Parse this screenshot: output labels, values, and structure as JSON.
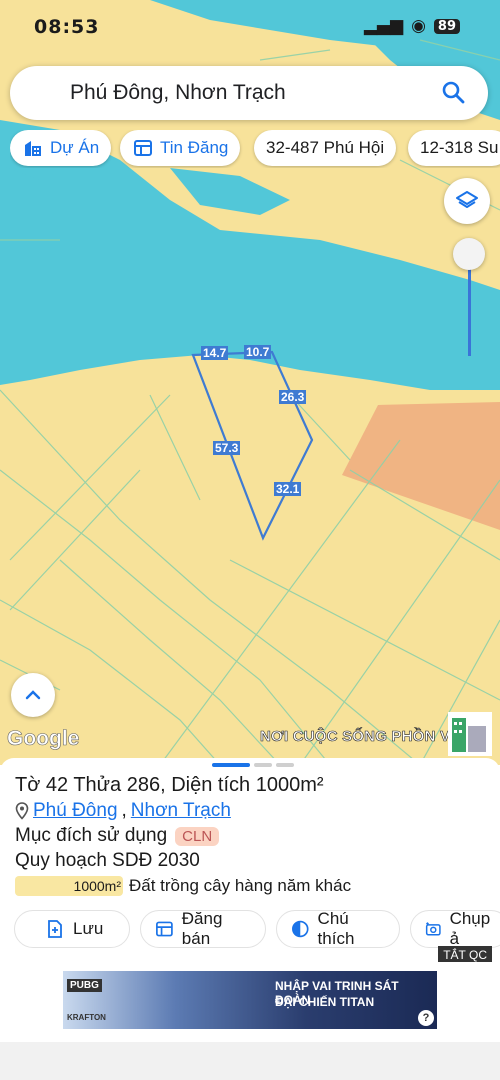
{
  "status_bar": {
    "time": "08:53",
    "signal": "▂▄▆",
    "battery": "89"
  },
  "search": {
    "query": "Phú Đông, Nhơn Trạch"
  },
  "chips": [
    {
      "label": "Dự Án",
      "icon": "building-icon"
    },
    {
      "label": "Tin Đăng",
      "icon": "listing-icon"
    },
    {
      "label": "32-487 Phú Hội"
    },
    {
      "label": "12-318 Su"
    }
  ],
  "map": {
    "edge_labels": [
      "14.7",
      "10.7",
      "26.3",
      "57.3",
      "32.1"
    ],
    "attribution": "Google",
    "promo_text": "NƠI CUỘC SỐNG PHỒN V",
    "colors": {
      "land": "#f7e29a",
      "water": "#52c7d8",
      "parcel_outline": "#3f7bd2",
      "zone": "#f0b483"
    }
  },
  "parcel": {
    "title": "Tờ 42 Thửa 286, Diện tích 1000m²",
    "ward": "Phú Đông",
    "separator": ",",
    "district": "Nhơn Trạch",
    "purpose_label": "Mục đích sử dụng",
    "purpose_code": "CLN",
    "plan_label": "Quy hoạch SDĐ 2030",
    "legend_area": "1000m²",
    "legend_text": "Đất trồng cây hàng năm khác"
  },
  "actions": [
    {
      "label": "Lưu",
      "icon": "save-icon"
    },
    {
      "label": "Đăng bán",
      "icon": "post-icon"
    },
    {
      "label": "Chú thích",
      "icon": "legend-icon"
    },
    {
      "label": "Chụp ả",
      "icon": "camera-icon"
    }
  ],
  "ad": {
    "close_label": "TẮT QC",
    "line1": "NHẬP VAI TRINH SÁT ĐOÀN",
    "line2": "ĐẠI CHIẾN TITAN",
    "brand": "PUBG",
    "sub": "KRAFTON",
    "info": "?"
  }
}
